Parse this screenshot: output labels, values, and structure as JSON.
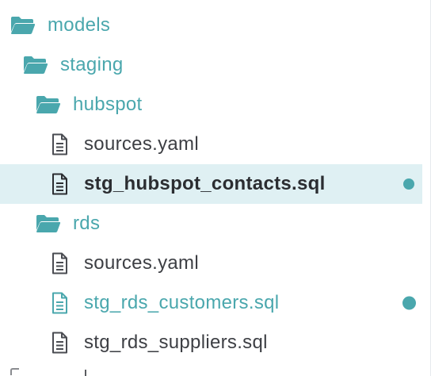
{
  "tree": {
    "items": [
      {
        "name": "models",
        "type": "folder",
        "depth": 0
      },
      {
        "name": "staging",
        "type": "folder",
        "depth": 1
      },
      {
        "name": "hubspot",
        "type": "folder",
        "depth": 2
      },
      {
        "name": "sources.yaml",
        "type": "file",
        "depth": 3
      },
      {
        "name": "stg_hubspot_contacts.sql",
        "type": "file",
        "depth": 3,
        "selected": true,
        "status": "modified"
      },
      {
        "name": "rds",
        "type": "folder",
        "depth": 2
      },
      {
        "name": "sources.yaml",
        "type": "file",
        "depth": 3
      },
      {
        "name": "stg_rds_customers.sql",
        "type": "file",
        "depth": 3,
        "status": "modified"
      },
      {
        "name": "stg_rds_suppliers.sql",
        "type": "file",
        "depth": 3
      }
    ]
  },
  "colors": {
    "accent": "#4aa7ad",
    "selected_background": "#dff0f3",
    "file_text": "#3d3f44",
    "file_icon": "#4a4c52"
  },
  "icons": {
    "folder": "folder-open-icon",
    "file": "file-text-icon"
  }
}
